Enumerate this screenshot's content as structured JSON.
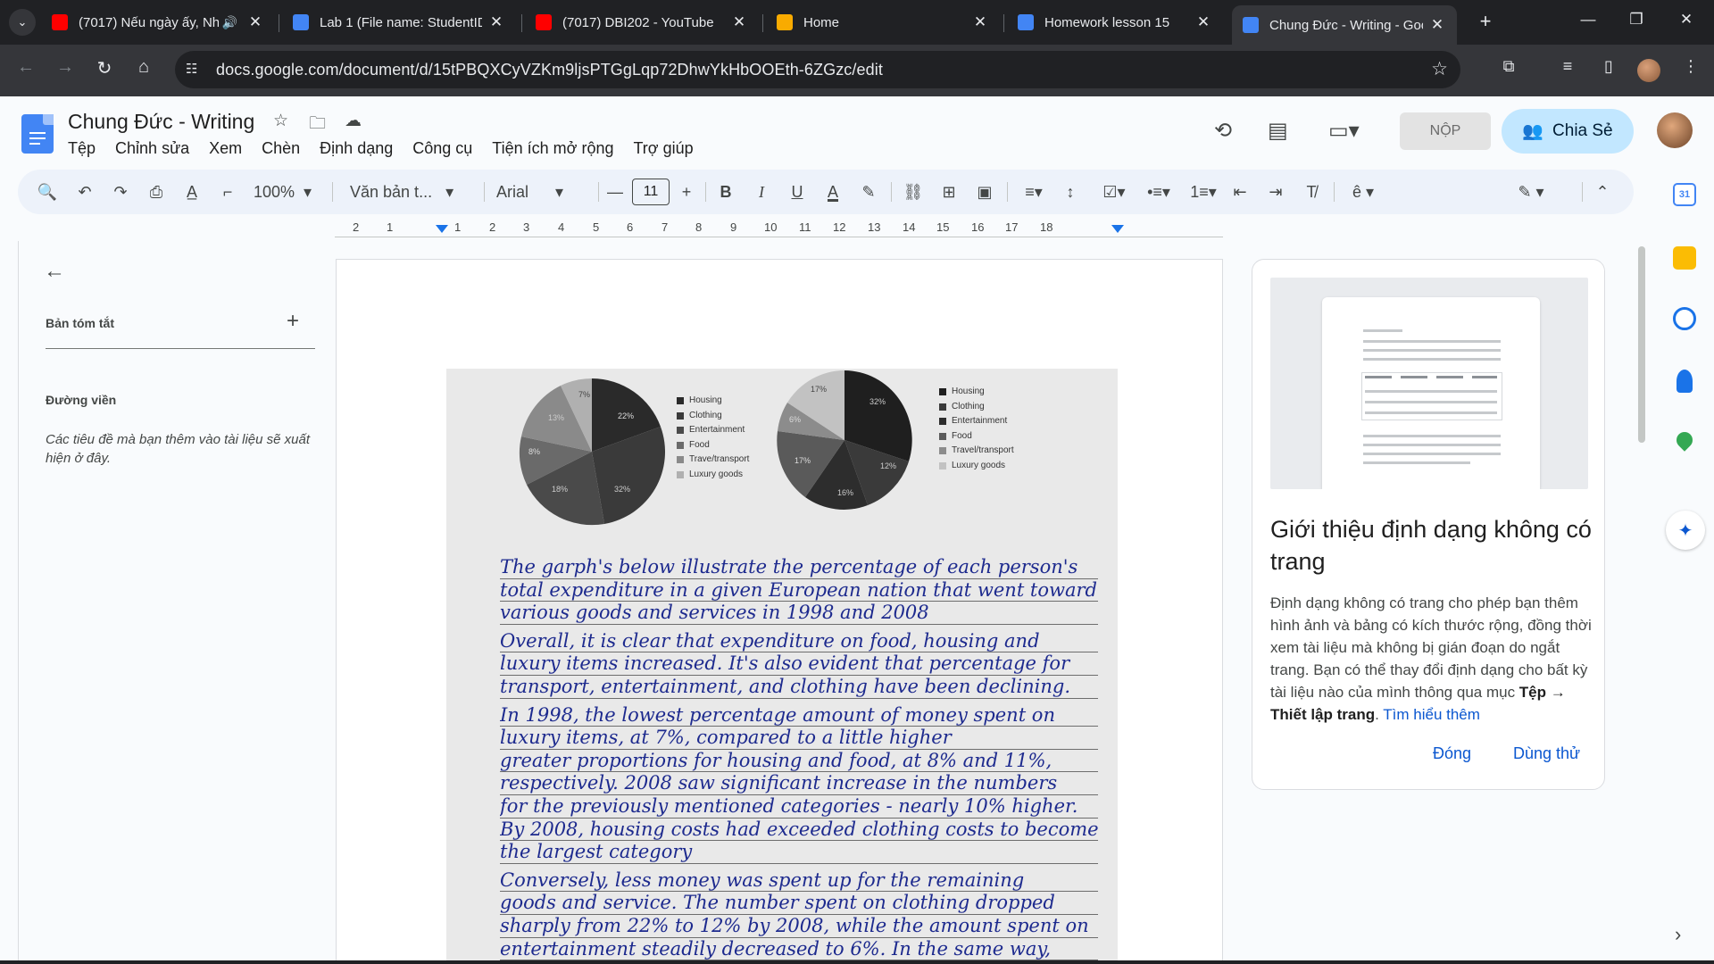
{
  "browser": {
    "tabs": [
      {
        "title": "(7017) Nếu ngày ấy, Nh",
        "favicon": "youtube-icon",
        "color": "#ff0000",
        "audio": true
      },
      {
        "title": "Lab 1 (File name: StudentID",
        "favicon": "classroom-icon",
        "color": "#4285f4"
      },
      {
        "title": "(7017) DBI202 - YouTube",
        "favicon": "youtube-icon",
        "color": "#ff0000"
      },
      {
        "title": "Home",
        "favicon": "home-icon",
        "color": "#f9ab00"
      },
      {
        "title": "Homework lesson 15",
        "favicon": "classroom-icon",
        "color": "#4285f4"
      },
      {
        "title": "Chung Đức - Writing - Goo",
        "favicon": "docs-icon",
        "color": "#4285f4",
        "active": true
      }
    ],
    "url": "docs.google.com/document/d/15tPBQXCyVZKm9ljsPTGgLqp72DhwYkHbOOEth-6ZGzc/edit"
  },
  "doc": {
    "title": "Chung Đức - Writing",
    "menu": [
      "Tệp",
      "Chỉnh sửa",
      "Xem",
      "Chèn",
      "Định dạng",
      "Công cụ",
      "Tiện ích mở rộng",
      "Trợ giúp"
    ],
    "submit_label": "NỘP",
    "share_label": "Chia Sẻ"
  },
  "toolbar": {
    "zoom": "100%",
    "style": "Văn bản t...",
    "font": "Arial",
    "font_size": "11"
  },
  "ruler": {
    "marks": [
      "2",
      "1",
      "1",
      "2",
      "3",
      "4",
      "5",
      "6",
      "7",
      "8",
      "9",
      "10",
      "11",
      "12",
      "13",
      "14",
      "15",
      "16",
      "17",
      "18"
    ]
  },
  "outline": {
    "summary_label": "Bản tóm tắt",
    "outline_label": "Đường viền",
    "hint": "Các tiêu đề mà bạn thêm vào tài liệu sẽ xuất hiện ở đây."
  },
  "photo": {
    "legend": [
      "Housing",
      "Clothing",
      "Entertainment",
      "Food",
      "Trave/transport",
      "Luxury goods"
    ],
    "legend2": [
      "Housing",
      "Clothing",
      "Entertainment",
      "Food",
      "Travel/transport",
      "Luxury goods"
    ],
    "pie1_labels": [
      "7%",
      "22%",
      "13%",
      "8%",
      "18%",
      "32%"
    ],
    "pie2_labels": [
      "17%",
      "32%",
      "6%",
      "17%",
      "16%",
      "12%"
    ],
    "handwriting": [
      [
        "The garph's below illustrate the percentage of each person's",
        "total expenditure in a given European nation that went toward",
        "various goods and services in 1998 and 2008"
      ],
      [
        "Overall, it is clear that expenditure on food, housing and",
        "luxury items increased. It's also evident that percentage for",
        "transport, entertainment, and clothing have been declining."
      ],
      [
        "In 1998, the lowest percentage amount of money spent on",
        "luxury items, at 7%, compared to a little higher",
        "greater proportions for housing and food, at 8% and 11%,",
        "respectively. 2008 saw significant increase in the numbers",
        "for the previously mentioned categories - nearly 10% higher.",
        "By 2008, housing costs had exceeded clothing costs to become",
        "the largest category"
      ],
      [
        "Conversely, less money was spent up for the remaining",
        "goods and service. The number spent on clothing dropped",
        "sharply from 22% to 12% by 2008, while the amount spent on",
        "entertainment steadily decreased to 6%. In the same way,"
      ]
    ]
  },
  "pageless_card": {
    "title": "Giới thiệu định dạng không có trang",
    "desc_start": "Định dạng không có trang cho phép bạn thêm hình ảnh và bảng có kích thước rộng, đồng thời xem tài liệu mà không bị gián đoạn do ngắt trang. Bạn có thể thay đổi định dạng cho bất kỳ tài liệu nào của mình thông qua mục ",
    "desc_bold": "Tệp → Thiết lập trang",
    "desc_end": ". ",
    "learn_more": "Tìm hiểu thêm",
    "close_label": "Đóng",
    "try_label": "Dùng thử"
  },
  "side_panel": {
    "calendar_day": "31"
  }
}
